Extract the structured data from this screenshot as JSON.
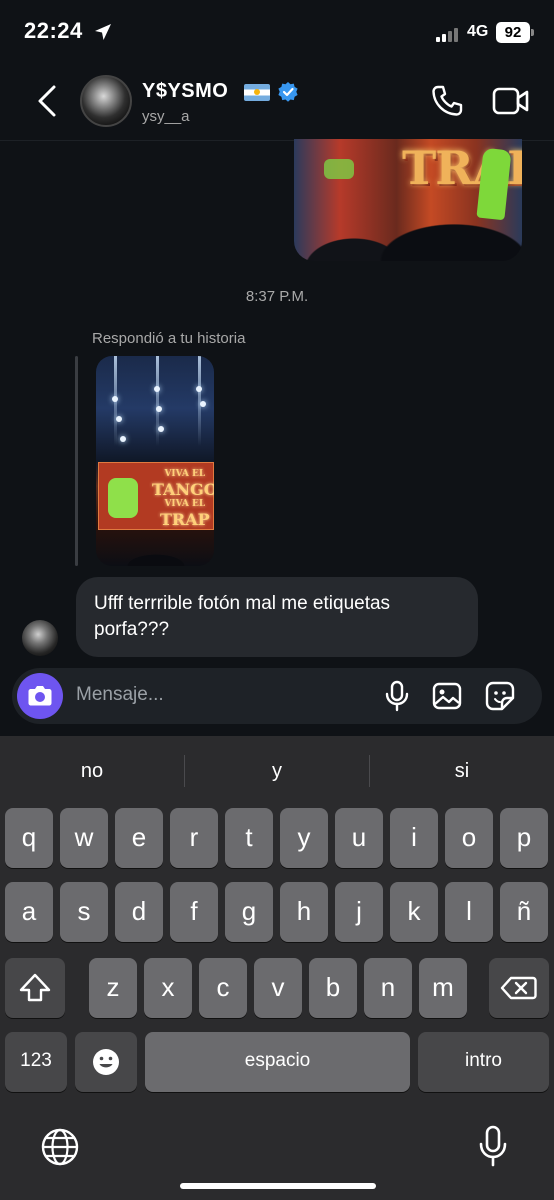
{
  "status_bar": {
    "time": "22:24",
    "network": "4G",
    "battery": "92"
  },
  "header": {
    "name": "Y$YSMO",
    "username": "ysy__a"
  },
  "chat": {
    "timestamp": "8:37 P.M.",
    "replied_label": "Respondió a tu historia",
    "sent_image_text": "TRAP",
    "story_text": [
      "VIVA EL",
      "TANGO",
      "VIVA EL",
      "TRAP"
    ],
    "message": "Ufff terrrible fotón mal me etiquetas porfa???"
  },
  "composer": {
    "placeholder": "Mensaje..."
  },
  "keyboard": {
    "suggestions": [
      "no",
      "y",
      "si"
    ],
    "row1": [
      "q",
      "w",
      "e",
      "r",
      "t",
      "y",
      "u",
      "i",
      "o",
      "p"
    ],
    "row2": [
      "a",
      "s",
      "d",
      "f",
      "g",
      "h",
      "j",
      "k",
      "l",
      "ñ"
    ],
    "row3": [
      "z",
      "x",
      "c",
      "v",
      "b",
      "n",
      "m"
    ],
    "numbers_key": "123",
    "space_key": "espacio",
    "return_key": "intro"
  },
  "icons": {
    "back": "chevron-left-icon",
    "call": "phone-icon",
    "video": "video-camera-icon",
    "camera": "camera-icon",
    "mic": "microphone-icon",
    "gallery": "image-icon",
    "sticker": "sticker-icon",
    "shift": "shift-icon",
    "delete": "backspace-icon",
    "emoji": "emoji-icon",
    "globe": "globe-icon",
    "dictation": "microphone-icon"
  },
  "colors": {
    "accent": "#6e55f0",
    "verified": "#3897f0",
    "bubble": "#26292e"
  }
}
